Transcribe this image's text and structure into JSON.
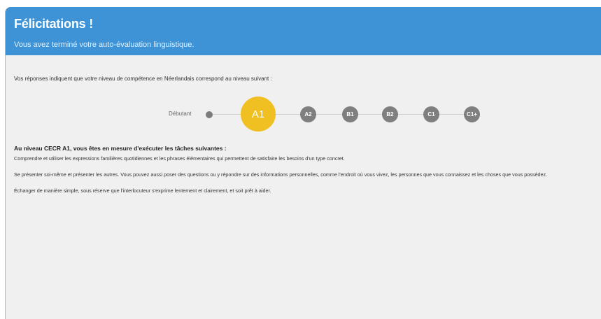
{
  "header": {
    "title": "Félicitations !",
    "subtitle": "Vous avez terminé votre auto-évaluation linguistique."
  },
  "intro": "Vos réponses indiquent que votre niveau de compétence en Néerlandais correspond au niveau suivant :",
  "scale": {
    "start_label": "Débutant",
    "levels": [
      "A1",
      "A2",
      "B1",
      "B2",
      "C1",
      "C1+"
    ],
    "current_level": "A1",
    "accent_color": "#f0bf22"
  },
  "description": {
    "title": "Au niveau CECR A1, vous êtes en mesure d'exécuter les tâches suivantes :",
    "items": [
      "Comprendre et utiliser les expressions familières quotidiennes et les phrases élémentaires qui permettent de satisfaire les besoins d'un type concret.",
      "Se présenter soi-même et présenter les autres. Vous pouvez aussi poser des questions ou y répondre sur des informations personnelles, comme l'endroit où vous vivez, les personnes que vous connaissez et les choses que vous possédez.",
      "Échanger de manière simple, sous réserve que l'interlocuteur s'exprime lentement et clairement, et soit prêt à aider."
    ]
  },
  "colors": {
    "header_bg": "#3d93d6",
    "level_bg": "#7f7f7f"
  }
}
